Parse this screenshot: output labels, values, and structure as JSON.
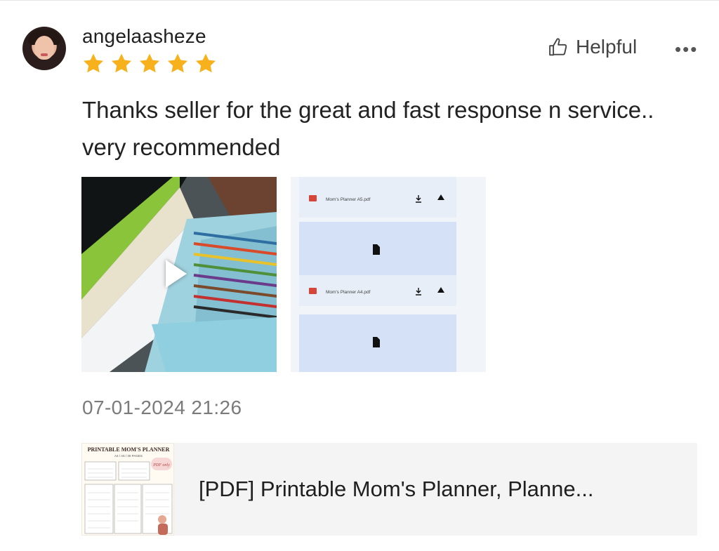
{
  "review": {
    "username": "angelaasheze",
    "rating": 5,
    "rating_max": 5,
    "helpful_label": "Helpful",
    "more_label": "•••",
    "text": "Thanks seller for the great and fast response n service.. very recommended",
    "timestamp": "07-01-2024 21:26"
  },
  "media": {
    "video": {
      "icon": "play-icon"
    },
    "screenshot": {
      "files": [
        {
          "name": "Mom's Planner A5.pdf",
          "badge": "PDF"
        },
        {
          "name": "Mom's Planner A4.pdf",
          "badge": "PDF"
        }
      ]
    }
  },
  "product": {
    "title": "[PDF] Printable Mom's Planner, Planne...",
    "thumb_title": "PRINTABLE MOM'S PLANNER",
    "thumb_subtitle": "A4 / A5 / 30 PAGES",
    "thumb_tag": "PDF only"
  },
  "colors": {
    "star": "#f7b11c",
    "text_muted": "#7b7b7b",
    "card_bg": "#f4f4f4",
    "file_card": "#d4e1f7"
  }
}
